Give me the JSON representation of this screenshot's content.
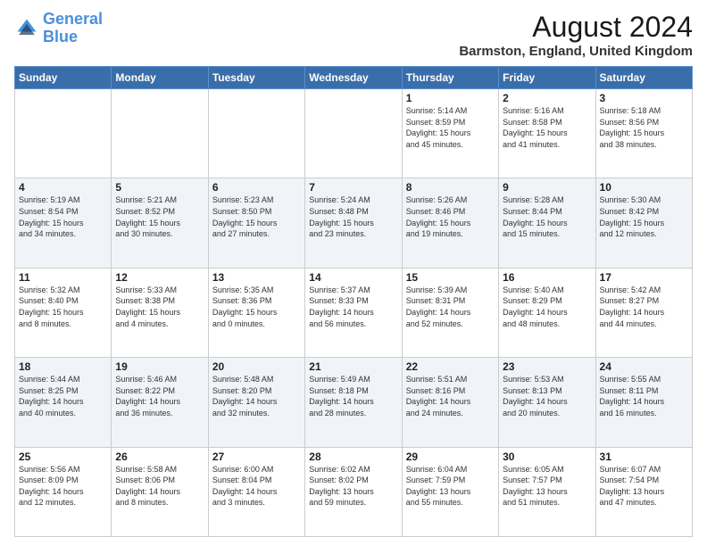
{
  "logo": {
    "line1": "General",
    "line2": "Blue"
  },
  "header": {
    "title": "August 2024",
    "subtitle": "Barmston, England, United Kingdom"
  },
  "weekdays": [
    "Sunday",
    "Monday",
    "Tuesday",
    "Wednesday",
    "Thursday",
    "Friday",
    "Saturday"
  ],
  "weeks": [
    [
      {
        "day": "",
        "info": ""
      },
      {
        "day": "",
        "info": ""
      },
      {
        "day": "",
        "info": ""
      },
      {
        "day": "",
        "info": ""
      },
      {
        "day": "1",
        "info": "Sunrise: 5:14 AM\nSunset: 8:59 PM\nDaylight: 15 hours\nand 45 minutes."
      },
      {
        "day": "2",
        "info": "Sunrise: 5:16 AM\nSunset: 8:58 PM\nDaylight: 15 hours\nand 41 minutes."
      },
      {
        "day": "3",
        "info": "Sunrise: 5:18 AM\nSunset: 8:56 PM\nDaylight: 15 hours\nand 38 minutes."
      }
    ],
    [
      {
        "day": "4",
        "info": "Sunrise: 5:19 AM\nSunset: 8:54 PM\nDaylight: 15 hours\nand 34 minutes."
      },
      {
        "day": "5",
        "info": "Sunrise: 5:21 AM\nSunset: 8:52 PM\nDaylight: 15 hours\nand 30 minutes."
      },
      {
        "day": "6",
        "info": "Sunrise: 5:23 AM\nSunset: 8:50 PM\nDaylight: 15 hours\nand 27 minutes."
      },
      {
        "day": "7",
        "info": "Sunrise: 5:24 AM\nSunset: 8:48 PM\nDaylight: 15 hours\nand 23 minutes."
      },
      {
        "day": "8",
        "info": "Sunrise: 5:26 AM\nSunset: 8:46 PM\nDaylight: 15 hours\nand 19 minutes."
      },
      {
        "day": "9",
        "info": "Sunrise: 5:28 AM\nSunset: 8:44 PM\nDaylight: 15 hours\nand 15 minutes."
      },
      {
        "day": "10",
        "info": "Sunrise: 5:30 AM\nSunset: 8:42 PM\nDaylight: 15 hours\nand 12 minutes."
      }
    ],
    [
      {
        "day": "11",
        "info": "Sunrise: 5:32 AM\nSunset: 8:40 PM\nDaylight: 15 hours\nand 8 minutes."
      },
      {
        "day": "12",
        "info": "Sunrise: 5:33 AM\nSunset: 8:38 PM\nDaylight: 15 hours\nand 4 minutes."
      },
      {
        "day": "13",
        "info": "Sunrise: 5:35 AM\nSunset: 8:36 PM\nDaylight: 15 hours\nand 0 minutes."
      },
      {
        "day": "14",
        "info": "Sunrise: 5:37 AM\nSunset: 8:33 PM\nDaylight: 14 hours\nand 56 minutes."
      },
      {
        "day": "15",
        "info": "Sunrise: 5:39 AM\nSunset: 8:31 PM\nDaylight: 14 hours\nand 52 minutes."
      },
      {
        "day": "16",
        "info": "Sunrise: 5:40 AM\nSunset: 8:29 PM\nDaylight: 14 hours\nand 48 minutes."
      },
      {
        "day": "17",
        "info": "Sunrise: 5:42 AM\nSunset: 8:27 PM\nDaylight: 14 hours\nand 44 minutes."
      }
    ],
    [
      {
        "day": "18",
        "info": "Sunrise: 5:44 AM\nSunset: 8:25 PM\nDaylight: 14 hours\nand 40 minutes."
      },
      {
        "day": "19",
        "info": "Sunrise: 5:46 AM\nSunset: 8:22 PM\nDaylight: 14 hours\nand 36 minutes."
      },
      {
        "day": "20",
        "info": "Sunrise: 5:48 AM\nSunset: 8:20 PM\nDaylight: 14 hours\nand 32 minutes."
      },
      {
        "day": "21",
        "info": "Sunrise: 5:49 AM\nSunset: 8:18 PM\nDaylight: 14 hours\nand 28 minutes."
      },
      {
        "day": "22",
        "info": "Sunrise: 5:51 AM\nSunset: 8:16 PM\nDaylight: 14 hours\nand 24 minutes."
      },
      {
        "day": "23",
        "info": "Sunrise: 5:53 AM\nSunset: 8:13 PM\nDaylight: 14 hours\nand 20 minutes."
      },
      {
        "day": "24",
        "info": "Sunrise: 5:55 AM\nSunset: 8:11 PM\nDaylight: 14 hours\nand 16 minutes."
      }
    ],
    [
      {
        "day": "25",
        "info": "Sunrise: 5:56 AM\nSunset: 8:09 PM\nDaylight: 14 hours\nand 12 minutes."
      },
      {
        "day": "26",
        "info": "Sunrise: 5:58 AM\nSunset: 8:06 PM\nDaylight: 14 hours\nand 8 minutes."
      },
      {
        "day": "27",
        "info": "Sunrise: 6:00 AM\nSunset: 8:04 PM\nDaylight: 14 hours\nand 3 minutes."
      },
      {
        "day": "28",
        "info": "Sunrise: 6:02 AM\nSunset: 8:02 PM\nDaylight: 13 hours\nand 59 minutes."
      },
      {
        "day": "29",
        "info": "Sunrise: 6:04 AM\nSunset: 7:59 PM\nDaylight: 13 hours\nand 55 minutes."
      },
      {
        "day": "30",
        "info": "Sunrise: 6:05 AM\nSunset: 7:57 PM\nDaylight: 13 hours\nand 51 minutes."
      },
      {
        "day": "31",
        "info": "Sunrise: 6:07 AM\nSunset: 7:54 PM\nDaylight: 13 hours\nand 47 minutes."
      }
    ]
  ]
}
